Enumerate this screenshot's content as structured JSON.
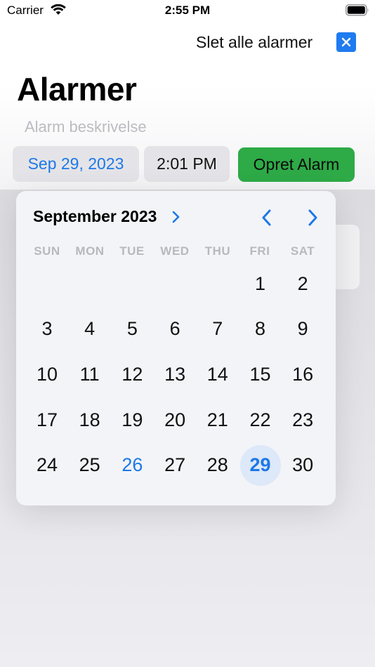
{
  "status_bar": {
    "carrier": "Carrier",
    "time": "2:55 PM"
  },
  "header": {
    "delete_all_label": "Slet alle alarmer",
    "close_icon": "x-icon",
    "title": "Alarmer"
  },
  "form": {
    "description_placeholder": "Alarm beskrivelse",
    "date_value": "Sep 29, 2023",
    "time_value": "2:01 PM",
    "create_button_label": "Opret Alarm"
  },
  "calendar": {
    "month_label": "September 2023",
    "weekdays": [
      "SUN",
      "MON",
      "TUE",
      "WED",
      "THU",
      "FRI",
      "SAT"
    ],
    "first_weekday_index": 5,
    "days_in_month": 30,
    "today": 26,
    "selected": 29
  },
  "colors": {
    "accent_blue": "#1d78e8",
    "create_green": "#2eaa47",
    "close_button_blue": "#1f7bf0"
  }
}
